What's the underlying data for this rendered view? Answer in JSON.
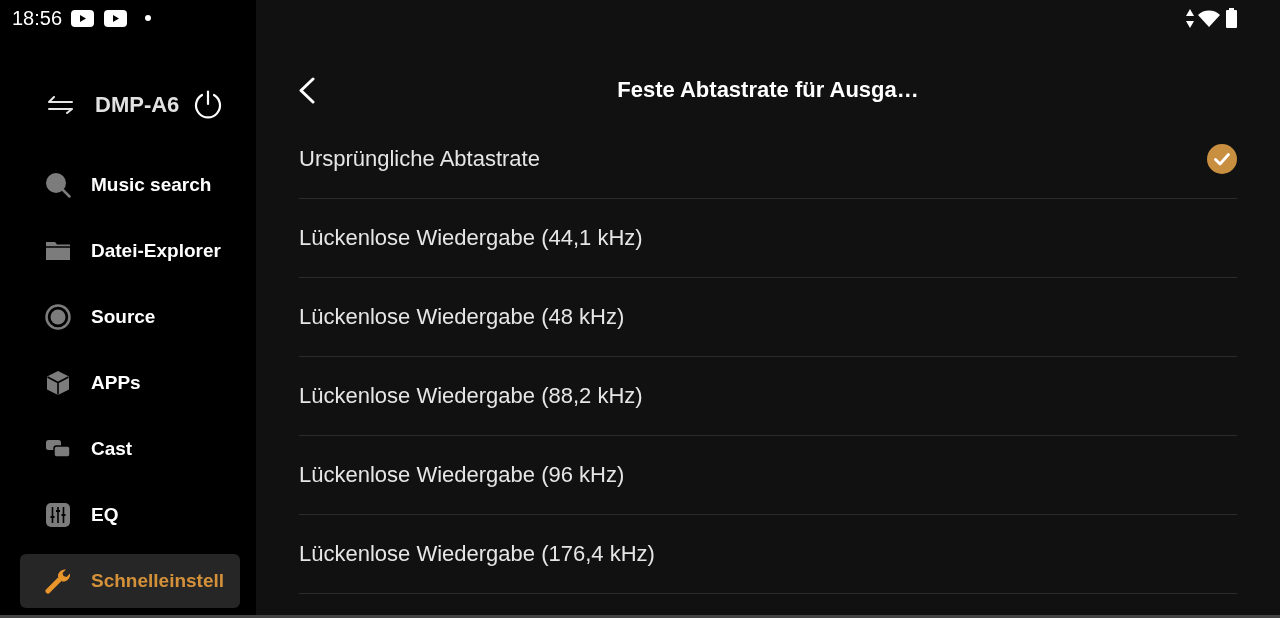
{
  "status_bar": {
    "time": "18:56"
  },
  "device": {
    "name": "DMP-A6"
  },
  "sidebar": {
    "items": [
      {
        "label": "Music search",
        "selected": false
      },
      {
        "label": "Datei-Explorer",
        "selected": false
      },
      {
        "label": "Source",
        "selected": false
      },
      {
        "label": "APPs",
        "selected": false
      },
      {
        "label": "Cast",
        "selected": false
      },
      {
        "label": "EQ",
        "selected": false
      },
      {
        "label": "Schnelleinstell",
        "selected": true
      }
    ]
  },
  "page": {
    "title": "Feste Abtastrate für Ausga…",
    "options": [
      {
        "label": "Ursprüngliche Abtastrate",
        "selected": true
      },
      {
        "label": "Lückenlose Wiedergabe (44,1 kHz)",
        "selected": false
      },
      {
        "label": "Lückenlose Wiedergabe (48 kHz)",
        "selected": false
      },
      {
        "label": "Lückenlose Wiedergabe (88,2 kHz)",
        "selected": false
      },
      {
        "label": "Lückenlose Wiedergabe (96 kHz)",
        "selected": false
      },
      {
        "label": "Lückenlose Wiedergabe (176,4 kHz)",
        "selected": false
      }
    ]
  }
}
